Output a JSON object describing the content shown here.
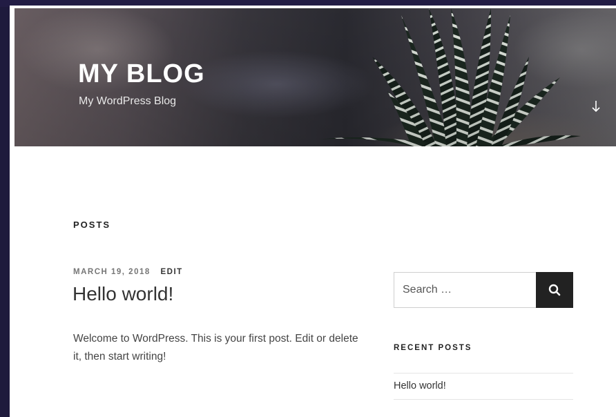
{
  "header": {
    "title": "MY BLOG",
    "description": "My WordPress Blog",
    "scroll_icon": "arrow-down-icon"
  },
  "main": {
    "section_heading": "POSTS",
    "post": {
      "date": "MARCH 19, 2018",
      "edit_label": "EDIT",
      "title": "Hello world!",
      "excerpt": "Welcome to WordPress. This is your first post. Edit or delete it, then start writing!"
    }
  },
  "sidebar": {
    "search": {
      "placeholder": "Search …",
      "button_icon": "search-icon"
    },
    "recent_posts": {
      "heading": "RECENT POSTS",
      "items": [
        {
          "label": "Hello world!"
        }
      ]
    }
  },
  "colors": {
    "page_background": "#ffffff",
    "frame_background": "#1e1a3c",
    "search_button": "#222222",
    "heading_text": "#222222",
    "meta_text": "#767676"
  }
}
